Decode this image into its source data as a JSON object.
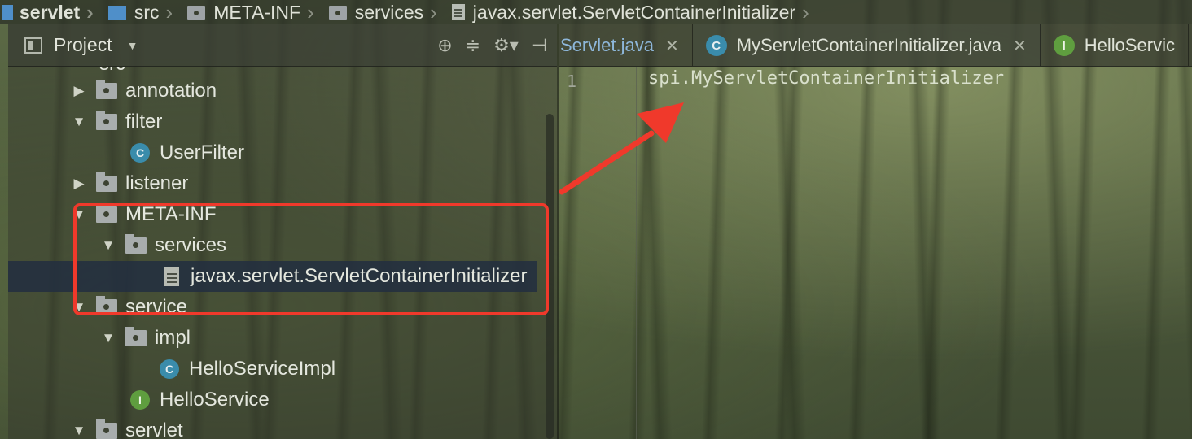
{
  "breadcrumb": [
    {
      "label": "servlet",
      "icon": "module-icon"
    },
    {
      "label": "src",
      "icon": "source-folder-icon"
    },
    {
      "label": "META-INF",
      "icon": "folder-icon"
    },
    {
      "label": "services",
      "icon": "folder-icon"
    },
    {
      "label": "javax.servlet.ServletContainerInitializer",
      "icon": "text-file-icon"
    }
  ],
  "project_panel": {
    "title": "Project",
    "toolbar": [
      "locate-icon",
      "collapse-all-icon",
      "settings-icon",
      "hide-icon"
    ],
    "partial_top_item": "src",
    "tree": [
      {
        "label": "annotation",
        "type": "folder",
        "expanded": false,
        "indent": 0
      },
      {
        "label": "filter",
        "type": "folder",
        "expanded": true,
        "indent": 0
      },
      {
        "label": "UserFilter",
        "type": "class",
        "badge": "C",
        "indent": 1
      },
      {
        "label": "listener",
        "type": "folder",
        "expanded": false,
        "indent": 0
      },
      {
        "label": "META-INF",
        "type": "folder",
        "expanded": true,
        "indent": 0
      },
      {
        "label": "services",
        "type": "folder",
        "expanded": true,
        "indent": 1
      },
      {
        "label": "javax.servlet.ServletContainerInitializer",
        "type": "file",
        "indent": 2,
        "selected": true
      },
      {
        "label": "service",
        "type": "folder",
        "expanded": true,
        "indent": 0
      },
      {
        "label": "impl",
        "type": "folder",
        "expanded": true,
        "indent": 1
      },
      {
        "label": "HelloServiceImpl",
        "type": "class",
        "badge": "C",
        "indent": 2
      },
      {
        "label": "HelloService",
        "type": "interface",
        "badge": "I",
        "indent": 1
      },
      {
        "label": "servlet",
        "type": "folder",
        "expanded": true,
        "indent": 0
      }
    ]
  },
  "editor": {
    "tabs": [
      {
        "label": "Servlet.java",
        "icon": "",
        "active": false
      },
      {
        "label": "MyServletContainerInitializer.java",
        "icon": "C",
        "active": true
      },
      {
        "label": "HelloServic",
        "icon": "I",
        "active": false
      }
    ],
    "lines": [
      {
        "number": "1",
        "text": "spi.MyServletContainerInitializer"
      }
    ]
  },
  "colors": {
    "annotation_red": "#f0392b",
    "class_badge": "#3a8cab",
    "interface_badge": "#5f9e3f",
    "selection": "#223040"
  }
}
